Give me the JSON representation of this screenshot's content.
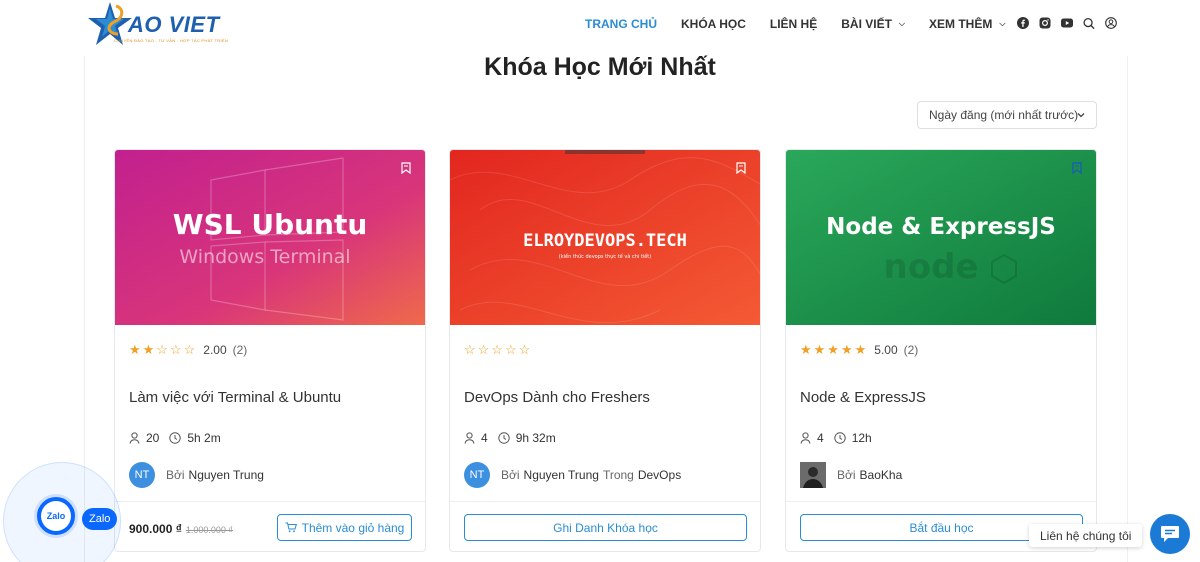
{
  "brand": {
    "logo_text": "AO VIET",
    "logo_tagline": "CHUYÊN ĐÀO TẠO - TƯ VẤN - HỢP TÁC PHÁT TRIỂN"
  },
  "nav": {
    "items": [
      {
        "label": "TRANG CHỦ",
        "active": true
      },
      {
        "label": "KHÓA HỌC"
      },
      {
        "label": "LIÊN HỆ"
      },
      {
        "label": "BÀI VIẾT",
        "dropdown": true
      },
      {
        "label": "XEM THÊM",
        "dropdown": true
      }
    ],
    "icons": [
      "facebook-icon",
      "instagram-icon",
      "youtube-icon",
      "search-icon",
      "user-icon"
    ]
  },
  "section": {
    "title": "Khóa Học Mới Nhất"
  },
  "sort": {
    "selected": "Ngày đăng (mới nhất trước)"
  },
  "cards": [
    {
      "thumb_title": "WSL Ubuntu",
      "thumb_subtitle": "Windows Terminal",
      "rating_value": "2.00",
      "rating_count": "(2)",
      "title": "Làm việc với Terminal & Ubuntu",
      "students": "20",
      "duration": "5h 2m",
      "avatar_initials": "NT",
      "by": "Bởi",
      "author": "Nguyen Trung",
      "price": "900.000 ₫",
      "old_price": "1.000.000 ₫",
      "button": "Thêm vào giỏ hàng"
    },
    {
      "thumb_title": "ELROYDEVOPS.TECH",
      "thumb_subtitle": "(kiến thức devops thực tế và chi tiết)",
      "rating_count": "",
      "title": "DevOps Dành cho Freshers",
      "students": "4",
      "duration": "9h 32m",
      "avatar_initials": "NT",
      "by": "Bởi",
      "author": "Nguyen Trung",
      "in_label": "Trong",
      "category": "DevOps",
      "button": "Ghi Danh Khóa học"
    },
    {
      "thumb_title": "Node & ExpressJS",
      "thumb_subtitle": "node",
      "rating_value": "5.00",
      "rating_count": "(2)",
      "title": "Node & ExpressJS",
      "students": "4",
      "duration": "12h",
      "by": "Bởi",
      "author": "BaoKha",
      "button": "Bắt đầu học"
    }
  ],
  "widgets": {
    "zalo_icon_text": "Zalo",
    "zalo_label": "Zalo",
    "contact_label": "Liên hệ chúng tôi"
  },
  "colors": {
    "accent": "#2a8dd4",
    "star": "#f0a024",
    "zalo": "#0a68ff"
  }
}
